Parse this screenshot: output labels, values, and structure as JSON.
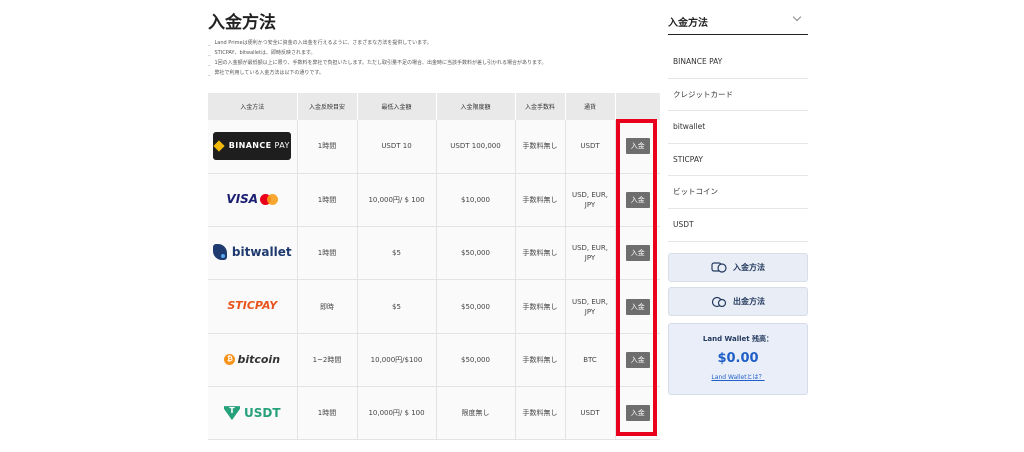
{
  "main": {
    "title": "入金方法",
    "notes": [
      "Land Primeは便利かつ安全に資金の入出金を行えるように、さまざまな方法を提供しています。",
      "STICPAY、bitwalletは、即時反映されます。",
      "1回の入金額が最低額以上に限り、手数料を弊社で負担いたします。ただし取引量不足の場合、出金時に当該手数料が差し引かれる場合があります。",
      "弊社で利用している入金方法は以下の通りです。"
    ],
    "table": {
      "headers": [
        "入金方法",
        "入金反映目安",
        "最低入金額",
        "入金限度額",
        "入金手数料",
        "通貨",
        ""
      ],
      "rows": [
        {
          "logo": "BINANCE PAY",
          "time": "1時間",
          "min": "USDT 10",
          "limit": "USDT 100,000",
          "fee": "手数料無し",
          "currency": "USDT",
          "action": "入金"
        },
        {
          "logo": "VISA",
          "time": "1時間",
          "min": "10,000円/ $ 100",
          "limit": "$10,000",
          "fee": "手数料無し",
          "currency": "USD, EUR, JPY",
          "action": "入金"
        },
        {
          "logo": "bitwallet",
          "time": "1時間",
          "min": "$5",
          "limit": "$50,000",
          "fee": "手数料無し",
          "currency": "USD, EUR, JPY",
          "action": "入金"
        },
        {
          "logo": "STICPAY",
          "time": "即時",
          "min": "$5",
          "limit": "$50,000",
          "fee": "手数料無し",
          "currency": "USD, EUR, JPY",
          "action": "入金"
        },
        {
          "logo": "bitcoin",
          "time": "1~2時間",
          "min": "10,000円/$100",
          "limit": "$50,000",
          "fee": "手数料無し",
          "currency": "BTC",
          "action": "入金"
        },
        {
          "logo": "USDT",
          "time": "1時間",
          "min": "10,000円/ $ 100",
          "limit": "限度無し",
          "fee": "手数料無し",
          "currency": "USDT",
          "action": "入金"
        }
      ]
    },
    "colors": {
      "highlight": "#e8001c",
      "button": "#6e6e6e",
      "header_bg": "#e9e9e9"
    }
  },
  "sidebar": {
    "title": "入金方法",
    "items": [
      "BINANCE PAY",
      "クレジットカード",
      "bitwallet",
      "STICPAY",
      "ビットコイン",
      "USDT"
    ],
    "deposit_button": "入金方法",
    "withdraw_button": "出金方法",
    "wallet": {
      "label": "Land Wallet 残高：",
      "balance": "$0.00",
      "link": "Land Walletとは？"
    }
  }
}
